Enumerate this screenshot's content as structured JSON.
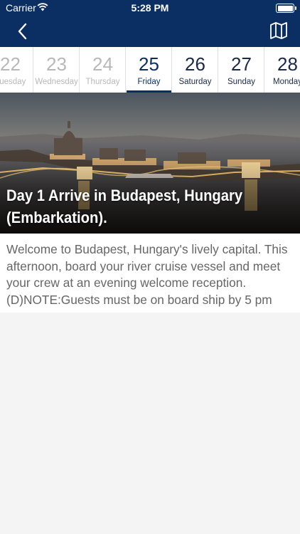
{
  "status": {
    "carrier": "Carrier",
    "time": "5:28 PM"
  },
  "nav": {
    "back_icon": "chevron-left-icon",
    "map_icon": "map-icon"
  },
  "dates": [
    {
      "num": "22",
      "day": "Tuesday",
      "state": "past"
    },
    {
      "num": "23",
      "day": "Wednesday",
      "state": "past"
    },
    {
      "num": "24",
      "day": "Thursday",
      "state": "past"
    },
    {
      "num": "25",
      "day": "Friday",
      "state": "selected"
    },
    {
      "num": "26",
      "day": "Saturday",
      "state": "future"
    },
    {
      "num": "27",
      "day": "Sunday",
      "state": "future"
    },
    {
      "num": "28",
      "day": "Monday",
      "state": "future"
    }
  ],
  "day": {
    "title": "Day 1 Arrive in Budapest, Hungary (Embarkation).",
    "description": "Welcome to Budapest, Hungary's lively capital. This afternoon, board your river cruise vessel and meet your crew at an evening welcome reception. (D)NOTE:Guests must be on board ship by 5 pm"
  },
  "colors": {
    "nav_background": "#0c2f63",
    "selected_date": "#0c2f63",
    "past_date": "#b8b8b8",
    "description_text": "#666666"
  }
}
